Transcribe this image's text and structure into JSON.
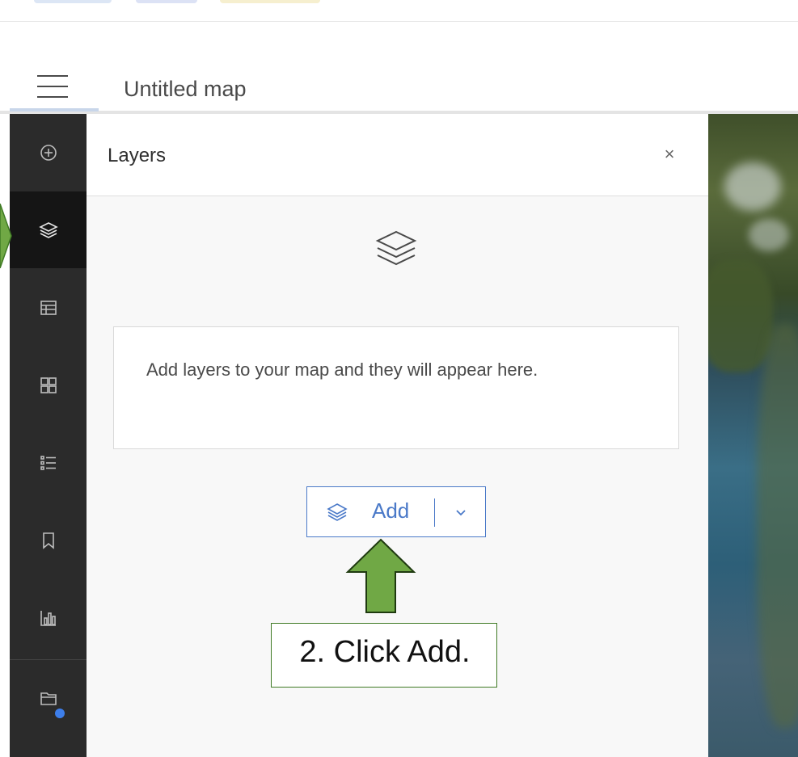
{
  "header": {
    "title": "Untitled map"
  },
  "actionbar": {
    "items": [
      {
        "name": "add",
        "icon": "plus-circle-icon"
      },
      {
        "name": "layers",
        "icon": "layers-icon",
        "active": true
      },
      {
        "name": "tables",
        "icon": "table-icon"
      },
      {
        "name": "basemap",
        "icon": "basemap-gallery-icon"
      },
      {
        "name": "legend",
        "icon": "legend-icon"
      },
      {
        "name": "bookmarks",
        "icon": "bookmark-icon"
      },
      {
        "name": "charts",
        "icon": "chart-icon"
      },
      {
        "name": "map-properties",
        "icon": "map-properties-icon"
      }
    ]
  },
  "panel": {
    "title": "Layers",
    "close_label": "×",
    "empty_message": "Add layers to your map and they will appear here.",
    "add_button": {
      "label": "Add",
      "icon": "layers-icon",
      "dropdown_icon": "chevron-down-icon"
    }
  },
  "annotation": {
    "callout_text": "2. Click Add.",
    "arrow_color": "#70a845",
    "border_color": "#3f7a24"
  },
  "colors": {
    "accent": "#4a79c8",
    "actionbar_bg": "#2b2b2b",
    "actionbar_active": "#151515",
    "indicator_dot": "#3d7eea"
  }
}
